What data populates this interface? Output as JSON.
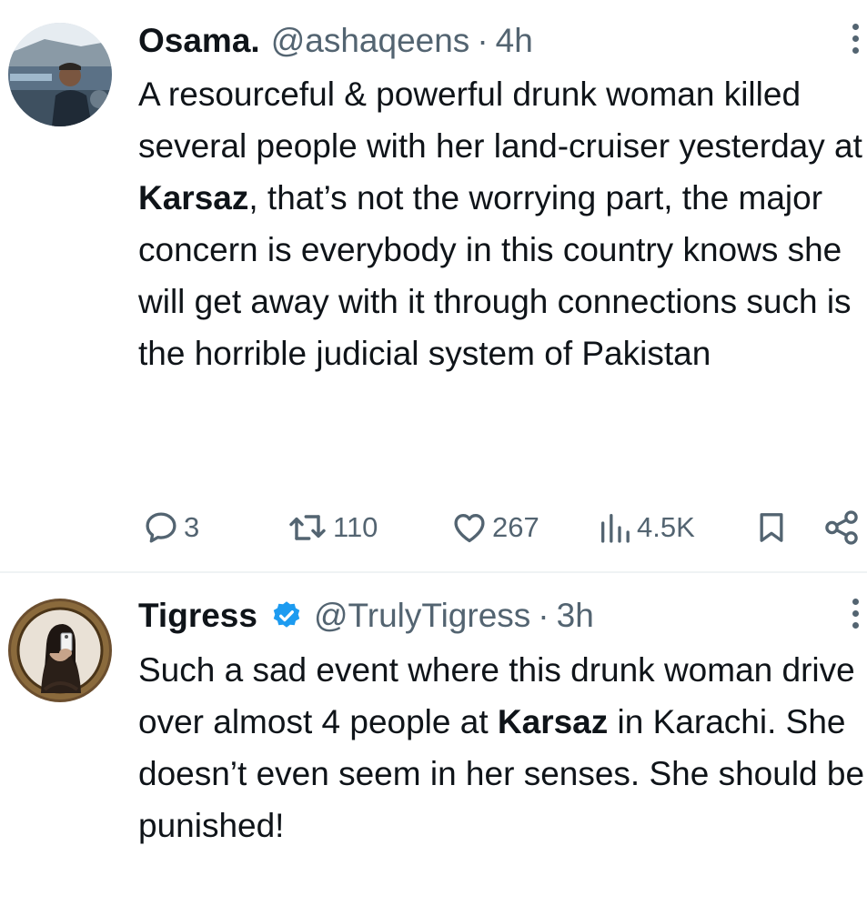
{
  "tweets": [
    {
      "name": "Osama.",
      "handle": "@ashaqeens",
      "separator": "·",
      "time": "4h",
      "verified": false,
      "avatar_icon": "profile-photo",
      "text_segments": [
        "A resourceful & powerful drunk woman killed several people with her land-cruiser yesterday at ",
        "Karsaz",
        ", that’s not the worrying part, the major concern is everybody in this country knows she will get away with it through connections such is the horrible judicial system of Pakistan"
      ],
      "replies": "3",
      "retweets": "110",
      "likes": "267",
      "views": "4.5K"
    },
    {
      "name": "Tigress",
      "handle": "@TrulyTigress",
      "separator": "·",
      "time": "3h",
      "verified": true,
      "avatar_icon": "profile-photo",
      "text_segments": [
        "Such a sad event where this drunk woman  drive over almost 4 people at ",
        "Karsaz",
        " in Karachi. She doesn’t even seem in her senses. She should be punished!"
      ]
    }
  ],
  "colors": {
    "text": "#0f1419",
    "secondary": "#536471",
    "verified_badge": "#1d9bf0",
    "divider": "#eff3f4"
  }
}
